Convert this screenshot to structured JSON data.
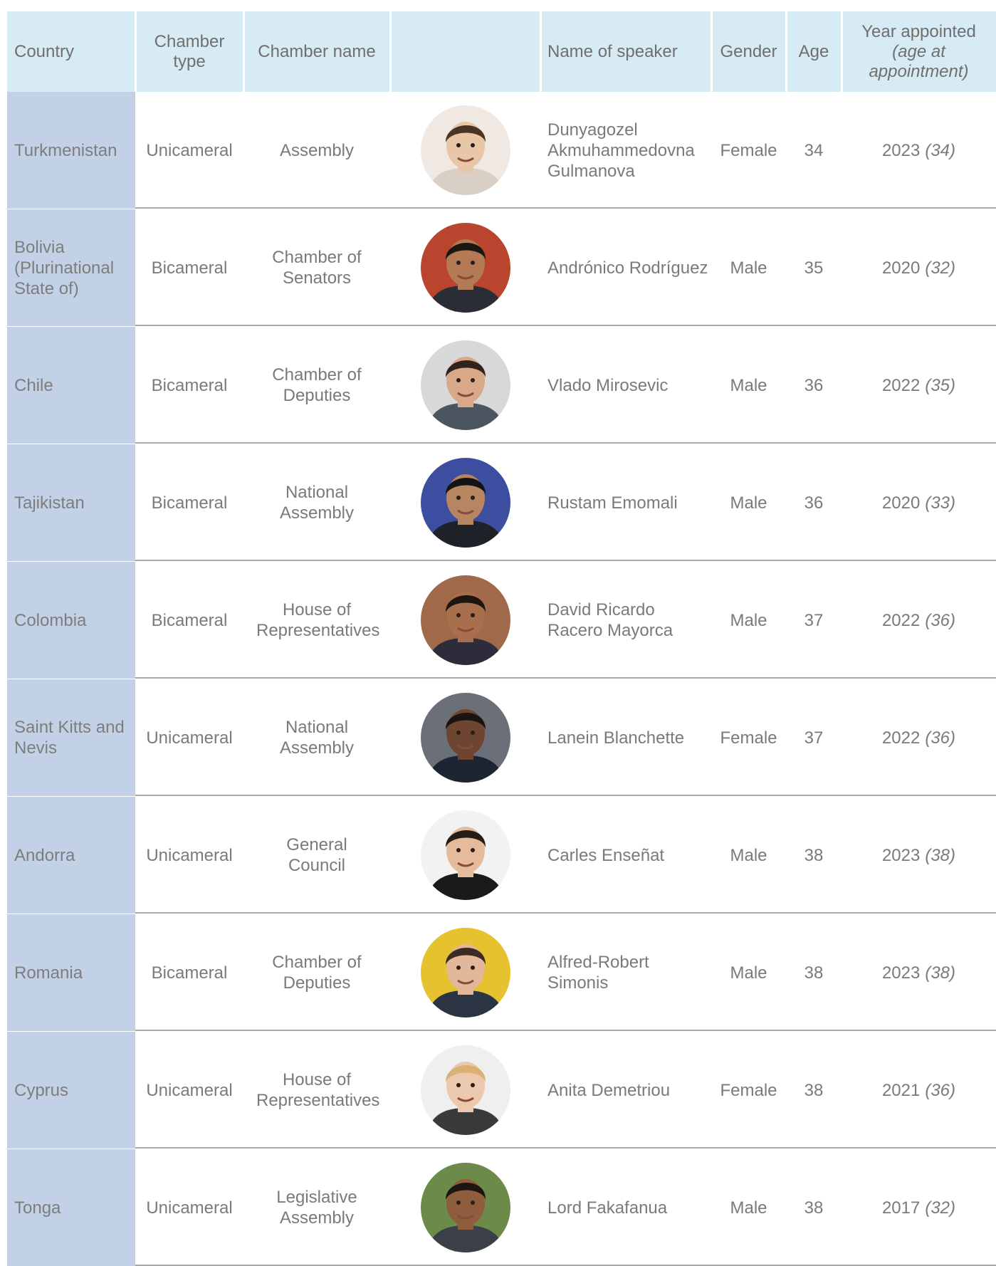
{
  "headers": {
    "country": "Country",
    "chamber_type": "Chamber type",
    "chamber_name": "Chamber name",
    "photo": "",
    "speaker": "Name of speaker",
    "gender": "Gender",
    "age": "Age",
    "year_line1": "Year appointed",
    "year_line2": "(age at appointment)"
  },
  "rows": [
    {
      "country": "Turkmenistan",
      "chamber_type": "Unicameral",
      "chamber_name": "Assembly",
      "speaker": "Dunyagozel Akmuhammedovna Gulmanova",
      "gender": "Female",
      "age": "34",
      "year": "2023",
      "age_at": "(34)",
      "photo_icon": "speaker-portrait",
      "bg": "#efe8e3",
      "skin": "#e9c6a8",
      "hair": "#4a3424",
      "suit": "#d9cfc5"
    },
    {
      "country": "Bolivia (Plurinational State of)",
      "chamber_type": "Bicameral",
      "chamber_name": "Chamber of Senators",
      "speaker": "Andrónico Rodríguez",
      "gender": "Male",
      "age": "35",
      "year": "2020",
      "age_at": "(32)",
      "photo_icon": "speaker-portrait",
      "bg": "#b9452f",
      "skin": "#b27a55",
      "hair": "#1c1712",
      "suit": "#2a2d35"
    },
    {
      "country": "Chile",
      "chamber_type": "Bicameral",
      "chamber_name": "Chamber of Deputies",
      "speaker": "Vlado Mirosevic",
      "gender": "Male",
      "age": "36",
      "year": "2022",
      "age_at": "(35)",
      "photo_icon": "speaker-portrait",
      "bg": "#d8d8d8",
      "skin": "#d9a888",
      "hair": "#2e241c",
      "suit": "#4b5560"
    },
    {
      "country": "Tajikistan",
      "chamber_type": "Bicameral",
      "chamber_name": "National Assembly",
      "speaker": "Rustam Emomali",
      "gender": "Male",
      "age": "36",
      "year": "2020",
      "age_at": "(33)",
      "photo_icon": "speaker-portrait",
      "bg": "#3d4da0",
      "skin": "#b88562",
      "hair": "#141414",
      "suit": "#1f2228"
    },
    {
      "country": "Colombia",
      "chamber_type": "Bicameral",
      "chamber_name": "House of Representatives",
      "speaker": "David Ricardo Racero Mayorca",
      "gender": "Male",
      "age": "37",
      "year": "2022",
      "age_at": "(36)",
      "photo_icon": "speaker-portrait",
      "bg": "#a06a4a",
      "skin": "#a86f4c",
      "hair": "#1d1610",
      "suit": "#2e2b3a"
    },
    {
      "country": "Saint Kitts and Nevis",
      "chamber_type": "Unicameral",
      "chamber_name": "National Assembly",
      "speaker": "Lanein Blanchette",
      "gender": "Female",
      "age": "37",
      "year": "2022",
      "age_at": "(36)",
      "photo_icon": "speaker-portrait",
      "bg": "#6b6f78",
      "skin": "#6e4530",
      "hair": "#1a1411",
      "suit": "#1d2432"
    },
    {
      "country": "Andorra",
      "chamber_type": "Unicameral",
      "chamber_name": "General Council",
      "speaker": "Carles Enseñat",
      "gender": "Male",
      "age": "38",
      "year": "2023",
      "age_at": "(38)",
      "photo_icon": "speaker-portrait",
      "bg": "#f2f2f2",
      "skin": "#e4bc9c",
      "hair": "#261d17",
      "suit": "#1a1a1a"
    },
    {
      "country": "Romania",
      "chamber_type": "Bicameral",
      "chamber_name": "Chamber of Deputies",
      "speaker": "Alfred-Robert Simonis",
      "gender": "Male",
      "age": "38",
      "year": "2023",
      "age_at": "(38)",
      "photo_icon": "speaker-portrait",
      "bg": "#e6c230",
      "skin": "#e3b79a",
      "hair": "#3a2c22",
      "suit": "#2b3442"
    },
    {
      "country": "Cyprus",
      "chamber_type": "Unicameral",
      "chamber_name": "House of Representatives",
      "speaker": "Anita Demetriou",
      "gender": "Female",
      "age": "38",
      "year": "2021",
      "age_at": "(36)",
      "photo_icon": "speaker-portrait",
      "bg": "#efefef",
      "skin": "#ecc9ae",
      "hair": "#d8b173",
      "suit": "#3a3a3a"
    },
    {
      "country": "Tonga",
      "chamber_type": "Unicameral",
      "chamber_name": "Legislative Assembly",
      "speaker": "Lord Fakafanua",
      "gender": "Male",
      "age": "38",
      "year": "2017",
      "age_at": "(32)",
      "photo_icon": "speaker-portrait",
      "bg": "#6c8a4a",
      "skin": "#8e5d3d",
      "hair": "#1b1612",
      "suit": "#3b3f47"
    }
  ]
}
